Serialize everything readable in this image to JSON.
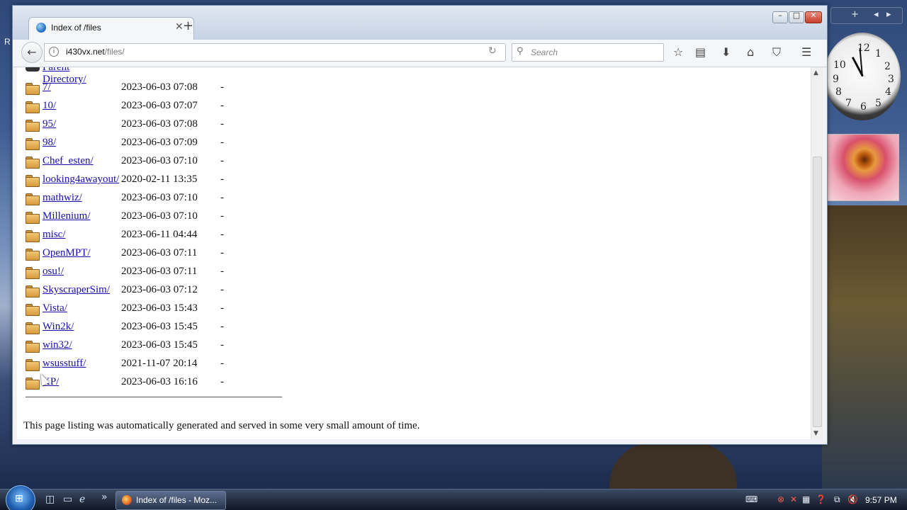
{
  "desktop": {
    "label": "R"
  },
  "gadgets": {
    "add": "+",
    "prev": "◂",
    "next": "▸"
  },
  "clock": {
    "n12": "12",
    "n1": "1",
    "n2": "2",
    "n3": "3",
    "n4": "4",
    "n5": "5",
    "n6": "6",
    "n7": "7",
    "n8": "8",
    "n9": "9",
    "n10": "10"
  },
  "window": {
    "min": "–",
    "max": "□",
    "close": "✕"
  },
  "tab": {
    "title": "Index of /files",
    "close": "✕",
    "new_tab": "+"
  },
  "nav": {
    "url_domain": "i430vx.net",
    "url_path": "/files/",
    "search_placeholder": "Search",
    "back": "←",
    "reload": "↻",
    "info": "i",
    "search_icon": "⚲",
    "bookmark": "☆",
    "reader": "▤",
    "download": "⬇",
    "home": "⌂",
    "pocket": "⛉",
    "menu": "☰"
  },
  "listing": {
    "parent": "Parent Directory/",
    "entries": [
      {
        "name": "7/",
        "date": "2023-06-03 07:08",
        "size": "-"
      },
      {
        "name": "10/",
        "date": "2023-06-03 07:07",
        "size": "-"
      },
      {
        "name": "95/",
        "date": "2023-06-03 07:08",
        "size": "-"
      },
      {
        "name": "98/",
        "date": "2023-06-03 07:09",
        "size": "-"
      },
      {
        "name": "Chef_esten/",
        "date": "2023-06-03 07:10",
        "size": "-"
      },
      {
        "name": "looking4awayout/",
        "date": "2020-02-11 13:35",
        "size": "-"
      },
      {
        "name": "mathwiz/",
        "date": "2023-06-03 07:10",
        "size": "-"
      },
      {
        "name": "Millenium/",
        "date": "2023-06-03 07:10",
        "size": "-"
      },
      {
        "name": "misc/",
        "date": "2023-06-11 04:44",
        "size": "-"
      },
      {
        "name": "OpenMPT/",
        "date": "2023-06-03 07:11",
        "size": "-"
      },
      {
        "name": "osu!/",
        "date": "2023-06-03 07:11",
        "size": "-"
      },
      {
        "name": "SkyscraperSim/",
        "date": "2023-06-03 07:12",
        "size": "-"
      },
      {
        "name": "Vista/",
        "date": "2023-06-03 15:43",
        "size": "-"
      },
      {
        "name": "Win2k/",
        "date": "2023-06-03 15:45",
        "size": "-"
      },
      {
        "name": "win32/",
        "date": "2023-06-03 15:45",
        "size": "-"
      },
      {
        "name": "wsusstuff/",
        "date": "2021-11-07 20:14",
        "size": "-"
      },
      {
        "name": "XP/",
        "date": "2023-06-03 16:16",
        "size": "-"
      }
    ],
    "footer": "This page listing was automatically generated and served in some very small amount of time."
  },
  "scrollbar": {
    "up": "▲",
    "down": "▼"
  },
  "taskbar": {
    "start": "⊞",
    "ql_ie": "ℯ",
    "ql_desktop": "▭",
    "ql_more": "»",
    "ql_app": "◫",
    "task_label": "Index of /files - Moz...",
    "tray_keyboard": "⌨",
    "tray_1": "⊗",
    "tray_2": "✕",
    "tray_3": "▦",
    "tray_4": "❓",
    "tray_network": "⧉",
    "tray_volume": "🔇",
    "time": "9:57 PM"
  }
}
